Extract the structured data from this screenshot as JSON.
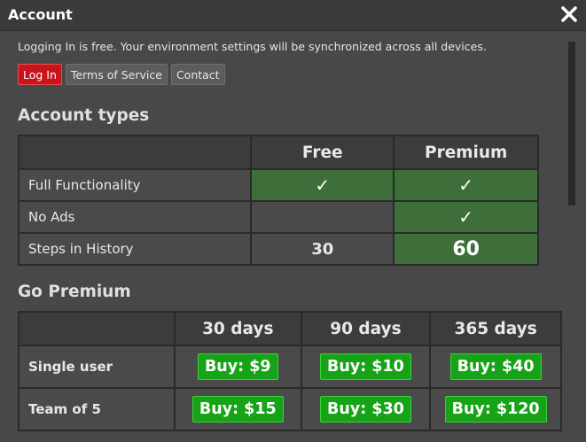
{
  "window": {
    "title": "Account"
  },
  "intro": "Logging In is free. Your environment settings will be synchronized across all devices.",
  "buttons": {
    "login": "Log In",
    "terms": "Terms of Service",
    "contact": "Contact"
  },
  "account_types": {
    "heading": "Account types",
    "columns": [
      "",
      "Free",
      "Premium"
    ],
    "rows": [
      {
        "label": "Full Functionality",
        "free": "✓",
        "premium": "✓"
      },
      {
        "label": "No Ads",
        "free": "",
        "premium": "✓"
      },
      {
        "label": "Steps in History",
        "free": "30",
        "premium": "60"
      }
    ]
  },
  "go_premium": {
    "heading": "Go Premium",
    "columns": [
      "",
      "30 days",
      "90 days",
      "365 days"
    ],
    "rows": [
      {
        "label": "Single user",
        "prices": [
          "Buy: $9",
          "Buy: $10",
          "Buy: $40"
        ]
      },
      {
        "label": "Team of 5",
        "prices": [
          "Buy: $15",
          "Buy: $30",
          "Buy: $120"
        ]
      }
    ]
  },
  "colors": {
    "login": "#c8141c",
    "feature_green": "#3e6f3a",
    "buy_green": "#17a317"
  },
  "icons": {
    "close": "close-icon",
    "check": "checkmark-icon"
  }
}
